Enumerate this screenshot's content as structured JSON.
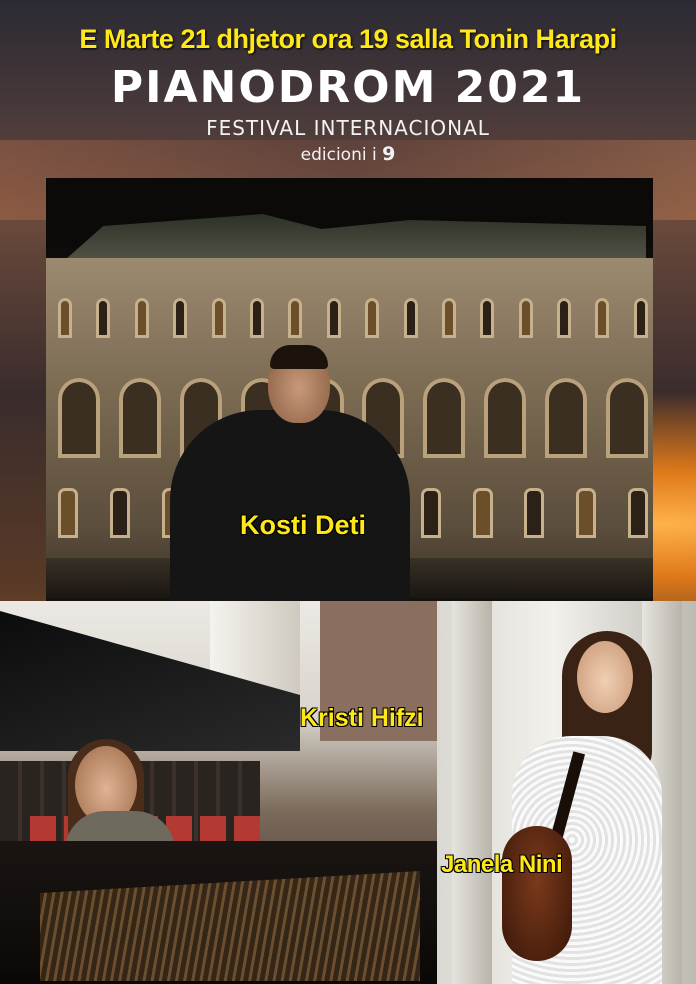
{
  "header": {
    "headline": "E Marte 21 dhjetor ora 19 salla Tonin Harapi",
    "title": "PIANODROM 2021",
    "subtitle": "FESTIVAL INTERNACIONAL",
    "edition_text": "edicioni i",
    "edition_number": "9"
  },
  "performers": [
    {
      "name": "Kosti Deti"
    },
    {
      "name": "Kristi Hifzi"
    },
    {
      "name": "Janela Nini"
    }
  ],
  "colors": {
    "accent": "#ffe81a",
    "title": "#ffffff"
  }
}
